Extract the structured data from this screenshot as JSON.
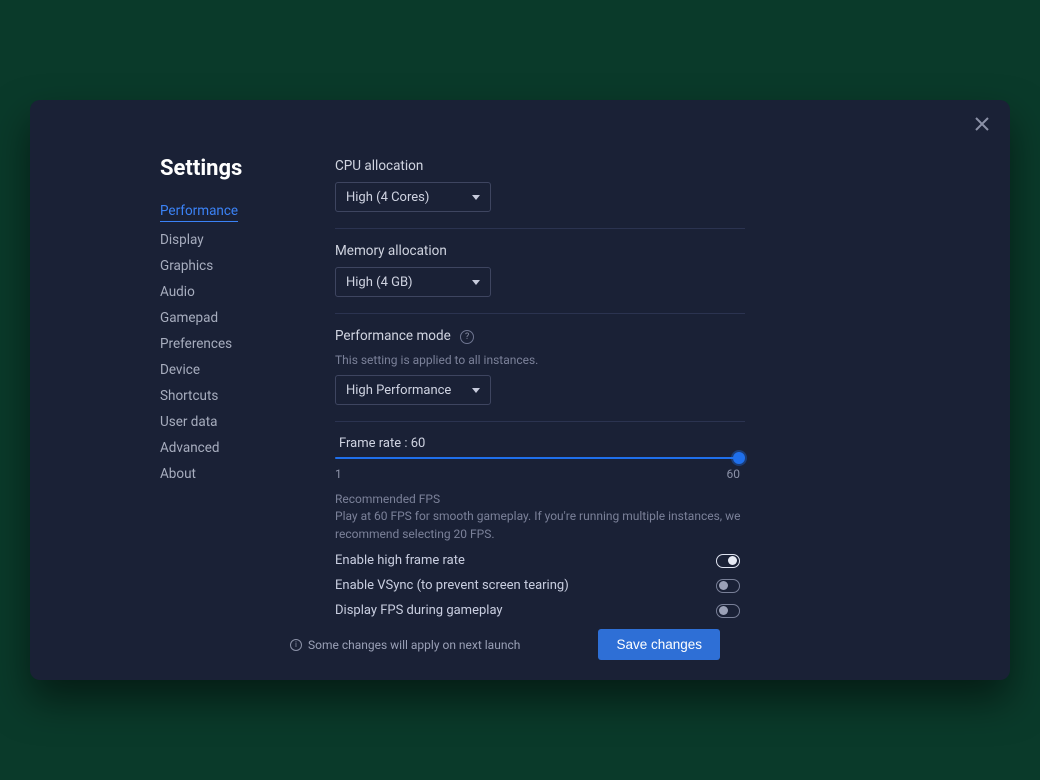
{
  "title": "Settings",
  "nav": {
    "items": [
      "Performance",
      "Display",
      "Graphics",
      "Audio",
      "Gamepad",
      "Preferences",
      "Device",
      "Shortcuts",
      "User data",
      "Advanced",
      "About"
    ],
    "active_index": 0
  },
  "cpu": {
    "label": "CPU allocation",
    "value": "High (4 Cores)"
  },
  "memory": {
    "label": "Memory allocation",
    "value": "High (4 GB)"
  },
  "perf_mode": {
    "label": "Performance mode",
    "hint": "This setting is applied to all instances.",
    "value": "High Performance"
  },
  "frame_rate": {
    "label_prefix": "Frame rate : ",
    "value": 60,
    "min": 1,
    "max": 60,
    "rec_title": "Recommended FPS",
    "rec_body": "Play at 60 FPS for smooth gameplay. If you're running multiple instances, we recommend selecting 20 FPS."
  },
  "toggles": {
    "high_fps": {
      "label": "Enable high frame rate",
      "on": true
    },
    "vsync": {
      "label": "Enable VSync (to prevent screen tearing)",
      "on": false
    },
    "show_fps": {
      "label": "Display FPS during gameplay",
      "on": false
    }
  },
  "footer": {
    "note": "Some changes will apply on next launch",
    "save": "Save changes"
  }
}
